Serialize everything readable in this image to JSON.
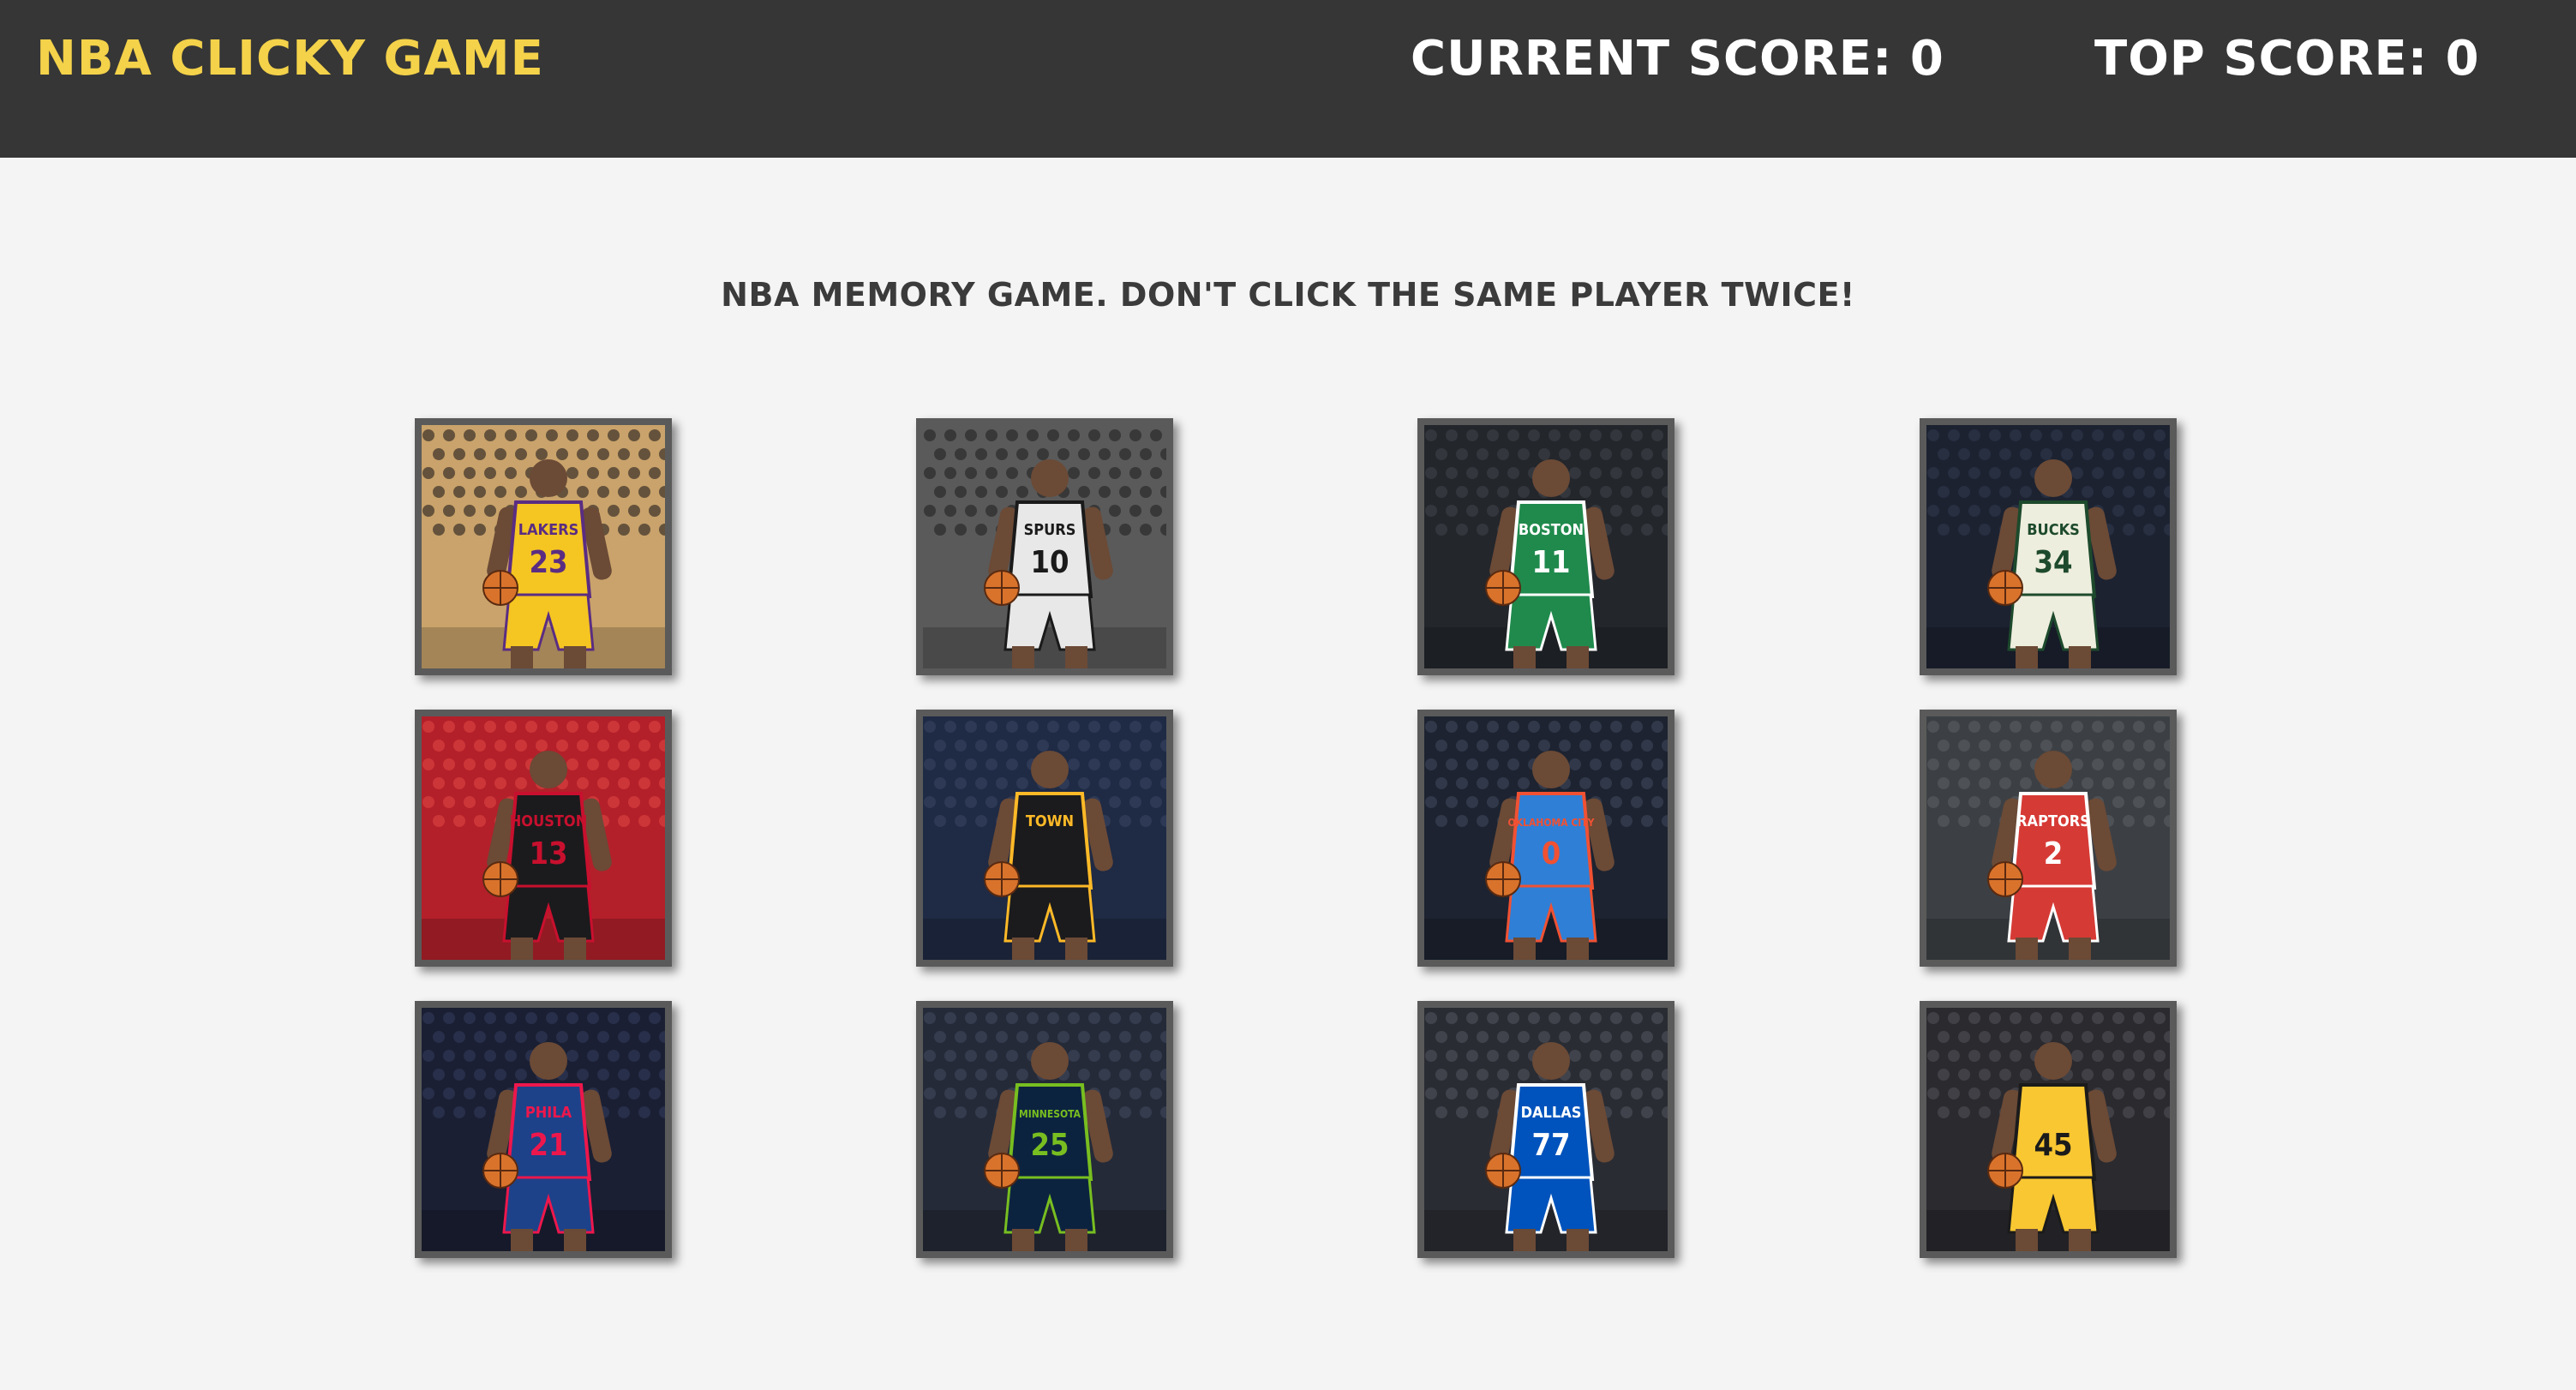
{
  "app": {
    "brand": "NBA Clicky Game",
    "current_score_label": "Current Score: 0",
    "top_score_label": "Top Score: 0",
    "colors": {
      "navbar_bg": "#363636",
      "brand": "#f4d24a",
      "score_text": "#ffffff",
      "page_bg": "#f4f4f4",
      "instructions_text": "#3b3b3b",
      "card_border": "#5a5a5a"
    }
  },
  "main": {
    "instructions": "NBA memory game. Don't click the same player twice!"
  },
  "cards": [
    {
      "team_text": "LAKERS",
      "number": "23",
      "jersey": "#f5c522",
      "trim": "#5a2d82",
      "bg": "#c9a36b",
      "crowd": "#3a2f28"
    },
    {
      "team_text": "SPURS",
      "number": "10",
      "jersey": "#e8e8e8",
      "trim": "#1a1a1a",
      "bg": "#5a5a5a",
      "crowd": "#2a2a2a"
    },
    {
      "team_text": "BOSTON",
      "number": "11",
      "jersey": "#1f8a4c",
      "trim": "#ffffff",
      "bg": "#23262b",
      "crowd": "#3b3f46"
    },
    {
      "team_text": "BUCKS",
      "number": "34",
      "jersey": "#eeeede",
      "trim": "#1d4a2c",
      "bg": "#1c2230",
      "crowd": "#2c3548"
    },
    {
      "team_text": "HOUSTON",
      "number": "13",
      "jersey": "#1b1b1d",
      "trim": "#c8102e",
      "bg": "#b3202a",
      "crowd": "#d8403f"
    },
    {
      "team_text": "TOWN",
      "number": "",
      "jersey": "#1b1b1d",
      "trim": "#fdb927",
      "bg": "#1f2a44",
      "crowd": "#34405e"
    },
    {
      "team_text": "OKLAHOMA CITY",
      "number": "0",
      "jersey": "#2f7fd6",
      "trim": "#f05133",
      "bg": "#1d2330",
      "crowd": "#3a4254"
    },
    {
      "team_text": "RAPTORS",
      "number": "2",
      "jersey": "#d63a35",
      "trim": "#ffffff",
      "bg": "#3c4044",
      "crowd": "#55595e"
    },
    {
      "team_text": "PHILA",
      "number": "21",
      "jersey": "#1d428a",
      "trim": "#ed174c",
      "bg": "#1a1f33",
      "crowd": "#2f3654"
    },
    {
      "team_text": "MINNESOTA",
      "number": "25",
      "jersey": "#0c2340",
      "trim": "#78be20",
      "bg": "#242a38",
      "crowd": "#3d4558"
    },
    {
      "team_text": "DALLAS",
      "number": "77",
      "jersey": "#0053bc",
      "trim": "#ffffff",
      "bg": "#2a2c33",
      "crowd": "#4a4d57"
    },
    {
      "team_text": "",
      "number": "45",
      "jersey": "#f9c732",
      "trim": "#1b1b1b",
      "bg": "#2a2a2f",
      "crowd": "#4c4a50"
    }
  ]
}
